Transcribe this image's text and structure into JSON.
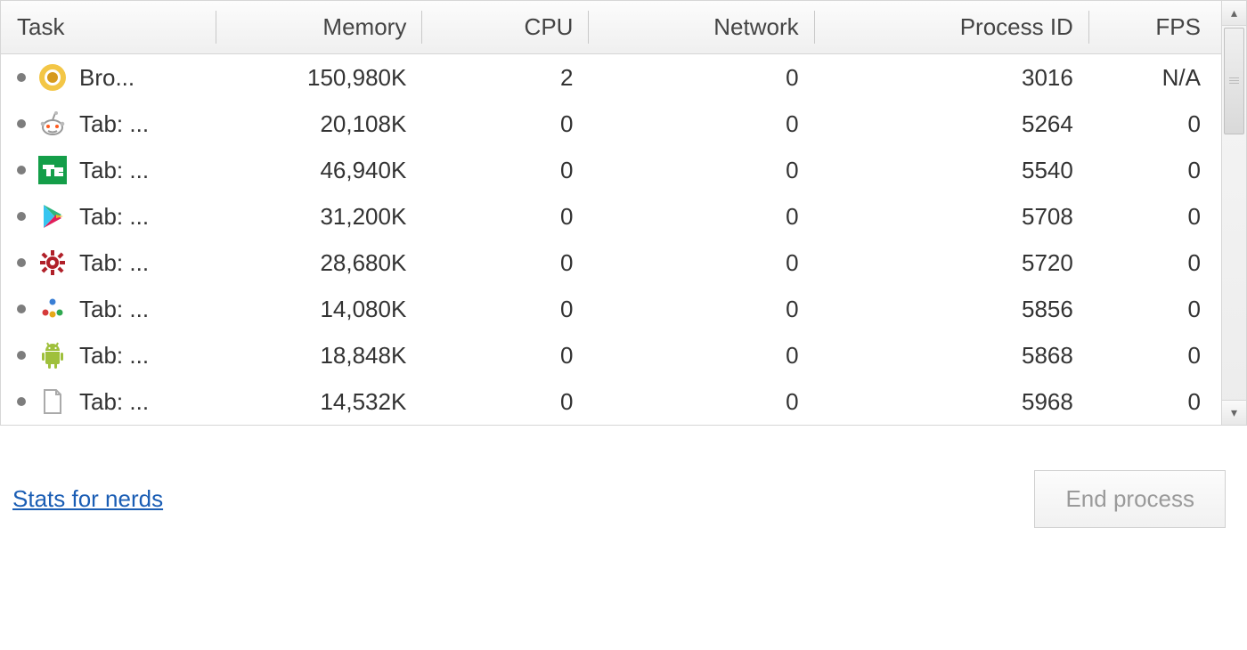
{
  "columns": {
    "task": "Task",
    "memory": "Memory",
    "cpu": "CPU",
    "network": "Network",
    "process_id": "Process ID",
    "fps": "FPS"
  },
  "rows": [
    {
      "icon": "chrome",
      "label": "Bro...",
      "memory": "150,980K",
      "cpu": "2",
      "network": "0",
      "pid": "3016",
      "fps": "N/A"
    },
    {
      "icon": "reddit",
      "label": "Tab: ...",
      "memory": "20,108K",
      "cpu": "0",
      "network": "0",
      "pid": "5264",
      "fps": "0"
    },
    {
      "icon": "techcrunch",
      "label": "Tab: ...",
      "memory": "46,940K",
      "cpu": "0",
      "network": "0",
      "pid": "5540",
      "fps": "0"
    },
    {
      "icon": "play",
      "label": "Tab: ...",
      "memory": "31,200K",
      "cpu": "0",
      "network": "0",
      "pid": "5708",
      "fps": "0"
    },
    {
      "icon": "gear-red",
      "label": "Tab: ...",
      "memory": "28,680K",
      "cpu": "0",
      "network": "0",
      "pid": "5720",
      "fps": "0"
    },
    {
      "icon": "dots",
      "label": "Tab: ...",
      "memory": "14,080K",
      "cpu": "0",
      "network": "0",
      "pid": "5856",
      "fps": "0"
    },
    {
      "icon": "android",
      "label": "Tab: ...",
      "memory": "18,848K",
      "cpu": "0",
      "network": "0",
      "pid": "5868",
      "fps": "0"
    },
    {
      "icon": "page",
      "label": "Tab: ...",
      "memory": "14,532K",
      "cpu": "0",
      "network": "0",
      "pid": "5968",
      "fps": "0"
    }
  ],
  "footer": {
    "stats_link": "Stats for nerds",
    "end_process": "End process"
  }
}
